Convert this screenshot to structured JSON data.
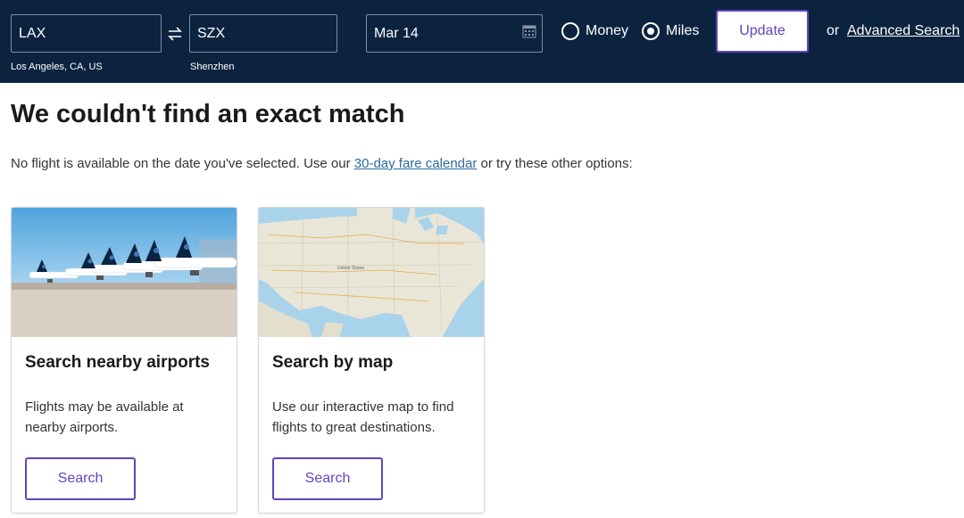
{
  "search": {
    "origin_code": "LAX",
    "origin_name": "Los Angeles, CA, US",
    "destination_code": "SZX",
    "destination_name": "Shenzhen",
    "date": "Mar 14",
    "fare_options": [
      "Money",
      "Miles"
    ],
    "selected_fare": "Miles",
    "update_label": "Update",
    "or_label": "or",
    "advanced_label": "Advanced Search",
    "icons": {
      "swap": "swap-arrows-icon",
      "calendar": "calendar-icon"
    }
  },
  "main": {
    "heading": "We couldn't find an exact match",
    "message_before": "No flight is available on the date you've selected. Use our ",
    "message_link": "30-day fare calendar",
    "message_after": " or try these other options:"
  },
  "cards": [
    {
      "image": "airplanes-at-gate-photo",
      "title": "Search nearby airports",
      "description": "Flights may be available at nearby airports.",
      "button_label": "Search"
    },
    {
      "image": "us-map-image",
      "title": "Search by map",
      "description": "Use our interactive map to find flights to great destinations.",
      "button_label": "Search"
    }
  ],
  "colors": {
    "header_bg": "#0c2340",
    "accent": "#6244bb",
    "link": "#2b6aa0"
  }
}
